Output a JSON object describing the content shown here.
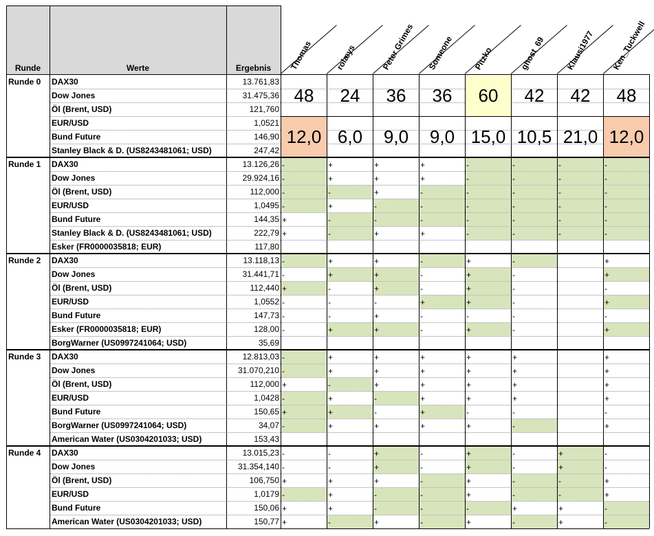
{
  "header": {
    "runde": "Runde",
    "werte": "Werte",
    "ergebnis": "Ergebnis"
  },
  "players": [
    "Thomas",
    "rolæys",
    "Peter Grimes",
    "Someone",
    "Pitzko",
    "ghost_69",
    "Klausi1977",
    "Ken_Tuckwell"
  ],
  "rounds": [
    {
      "label": "Runde 0",
      "rows": [
        {
          "werte": "DAX30",
          "ergebnis": "13.761,83"
        },
        {
          "werte": "Dow Jones",
          "ergebnis": "31.475,36"
        },
        {
          "werte": "Öl (Brent, USD)",
          "ergebnis": "121,760"
        },
        {
          "werte": "EUR/USD",
          "ergebnis": "1,0521"
        },
        {
          "werte": "Bund Future",
          "ergebnis": "146,90"
        },
        {
          "werte": "Stanley Black & D. (US8243481061; USD)",
          "ergebnis": "247,42"
        }
      ],
      "totals1": [
        "48",
        "24",
        "36",
        "36",
        "60",
        "42",
        "42",
        "48"
      ],
      "totals2": [
        "12,0",
        "6,0",
        "9,0",
        "9,0",
        "15,0",
        "10,5",
        "21,0",
        "12,0"
      ]
    },
    {
      "label": "Runde 1",
      "rows": [
        {
          "werte": "DAX30",
          "ergebnis": "13.126,26",
          "s": [
            "-",
            "+",
            "+",
            "+",
            "-",
            "-",
            "-",
            "-"
          ],
          "g": [
            1,
            0,
            0,
            0,
            1,
            1,
            1,
            1
          ]
        },
        {
          "werte": "Dow Jones",
          "ergebnis": "29.924,16",
          "s": [
            "-",
            "+",
            "+",
            "+",
            "-",
            "-",
            "-",
            "-"
          ],
          "g": [
            1,
            0,
            0,
            0,
            1,
            1,
            1,
            1
          ]
        },
        {
          "werte": "Öl (Brent, USD)",
          "ergebnis": "112,000",
          "s": [
            "-",
            "-",
            "+",
            "-",
            "-",
            "-",
            "-",
            "-"
          ],
          "g": [
            1,
            1,
            0,
            1,
            1,
            1,
            1,
            1
          ]
        },
        {
          "werte": "EUR/USD",
          "ergebnis": "1,0495",
          "s": [
            "-",
            "+",
            "-",
            "-",
            "-",
            "-",
            "-",
            "-"
          ],
          "g": [
            1,
            0,
            1,
            1,
            1,
            1,
            1,
            1
          ]
        },
        {
          "werte": "Bund Future",
          "ergebnis": "144,35",
          "s": [
            "+",
            "-",
            "-",
            "-",
            "-",
            "-",
            "-",
            "-"
          ],
          "g": [
            0,
            1,
            1,
            1,
            1,
            1,
            1,
            1
          ]
        },
        {
          "werte": "Stanley Black & D. (US8243481061; USD)",
          "ergebnis": "222,79",
          "s": [
            "+",
            "-",
            "+",
            "+",
            "-",
            "-",
            "-",
            "-"
          ],
          "g": [
            0,
            1,
            0,
            0,
            1,
            1,
            1,
            1
          ]
        },
        {
          "werte": "Esker (FR0000035818; EUR)",
          "ergebnis": "117,80",
          "s": [
            "",
            "",
            "",
            "",
            "",
            "",
            "",
            ""
          ],
          "g": [
            0,
            0,
            0,
            0,
            0,
            0,
            0,
            0
          ]
        }
      ]
    },
    {
      "label": "Runde 2",
      "rows": [
        {
          "werte": "DAX30",
          "ergebnis": "13.118,13",
          "s": [
            "-",
            "+",
            "+",
            "-",
            "+",
            "-",
            "",
            "+"
          ],
          "g": [
            1,
            0,
            0,
            1,
            0,
            1,
            0,
            0
          ]
        },
        {
          "werte": "Dow Jones",
          "ergebnis": "31.441,71",
          "s": [
            "-",
            "+",
            "+",
            "-",
            "+",
            "-",
            "",
            "+"
          ],
          "g": [
            0,
            1,
            1,
            0,
            1,
            0,
            0,
            1
          ]
        },
        {
          "werte": "Öl (Brent, USD)",
          "ergebnis": "112,440",
          "s": [
            "+",
            "-",
            "+",
            "-",
            "+",
            "-",
            "",
            "-"
          ],
          "g": [
            1,
            0,
            1,
            0,
            1,
            0,
            0,
            0
          ]
        },
        {
          "werte": "EUR/USD",
          "ergebnis": "1,0552",
          "s": [
            "-",
            "-",
            "-",
            "+",
            "+",
            "-",
            "",
            "+"
          ],
          "g": [
            0,
            0,
            0,
            1,
            1,
            0,
            0,
            1
          ]
        },
        {
          "werte": "Bund Future",
          "ergebnis": "147,73",
          "s": [
            "-",
            "-",
            "+",
            "-",
            "-",
            "-",
            "",
            "-"
          ],
          "g": [
            0,
            0,
            0,
            0,
            0,
            0,
            0,
            0
          ]
        },
        {
          "werte": "Esker (FR0000035818; EUR)",
          "ergebnis": "128,00",
          "s": [
            "-",
            "+",
            "+",
            "-",
            "+",
            "-",
            "",
            "+"
          ],
          "g": [
            0,
            1,
            1,
            0,
            1,
            0,
            0,
            1
          ]
        },
        {
          "werte": "BorgWarner (US0997241064; USD)",
          "ergebnis": "35,69",
          "s": [
            "",
            "",
            "",
            "",
            "",
            "",
            "",
            ""
          ],
          "g": [
            0,
            0,
            0,
            0,
            0,
            0,
            0,
            0
          ]
        }
      ]
    },
    {
      "label": "Runde 3",
      "rows": [
        {
          "werte": "DAX30",
          "ergebnis": "12.813,03",
          "s": [
            "-",
            "+",
            "+",
            "+",
            "+",
            "+",
            "",
            "+"
          ],
          "g": [
            1,
            0,
            0,
            0,
            0,
            0,
            0,
            0
          ]
        },
        {
          "werte": "Dow Jones",
          "ergebnis": "31.070,210",
          "s": [
            "-",
            "+",
            "+",
            "+",
            "+",
            "+",
            "",
            "+"
          ],
          "g": [
            1,
            0,
            0,
            0,
            0,
            0,
            0,
            0
          ]
        },
        {
          "werte": "Öl (Brent, USD)",
          "ergebnis": "112,000",
          "s": [
            "+",
            "-",
            "+",
            "+",
            "+",
            "+",
            "",
            "+"
          ],
          "g": [
            0,
            1,
            0,
            0,
            0,
            0,
            0,
            0
          ]
        },
        {
          "werte": "EUR/USD",
          "ergebnis": "1,0428",
          "s": [
            "-",
            "+",
            "-",
            "+",
            "+",
            "+",
            "",
            "+"
          ],
          "g": [
            1,
            0,
            1,
            0,
            0,
            0,
            0,
            0
          ]
        },
        {
          "werte": "Bund Future",
          "ergebnis": "150,65",
          "s": [
            "+",
            "+",
            "-",
            "+",
            "-",
            "-",
            "",
            "-"
          ],
          "g": [
            1,
            1,
            0,
            1,
            0,
            0,
            0,
            0
          ]
        },
        {
          "werte": "BorgWarner (US0997241064; USD)",
          "ergebnis": "34,07",
          "s": [
            "-",
            "+",
            "+",
            "+",
            "+",
            "-",
            "",
            "+"
          ],
          "g": [
            1,
            0,
            0,
            0,
            0,
            1,
            0,
            0
          ]
        },
        {
          "werte": "American Water (US0304201033; USD)",
          "ergebnis": "153,43",
          "s": [
            "",
            "",
            "",
            "",
            "",
            "",
            "",
            ""
          ],
          "g": [
            0,
            0,
            0,
            0,
            0,
            0,
            0,
            0
          ]
        }
      ]
    },
    {
      "label": "Runde 4",
      "rows": [
        {
          "werte": "DAX30",
          "ergebnis": "13.015,23",
          "s": [
            "-",
            "-",
            "+",
            "-",
            "+",
            "-",
            "+",
            "-"
          ],
          "g": [
            0,
            0,
            1,
            0,
            1,
            0,
            1,
            0
          ]
        },
        {
          "werte": "Dow Jones",
          "ergebnis": "31.354,140",
          "s": [
            "-",
            "-",
            "+",
            "-",
            "+",
            "-",
            "+",
            "-"
          ],
          "g": [
            0,
            0,
            1,
            0,
            1,
            0,
            1,
            0
          ]
        },
        {
          "werte": "Öl (Brent, USD)",
          "ergebnis": "106,750",
          "s": [
            "+",
            "+",
            "+",
            "-",
            "+",
            "-",
            "-",
            "+"
          ],
          "g": [
            0,
            0,
            0,
            1,
            0,
            1,
            1,
            0
          ]
        },
        {
          "werte": "EUR/USD",
          "ergebnis": "1,0179",
          "s": [
            "-",
            "+",
            "-",
            "-",
            "+",
            "-",
            "-",
            "+"
          ],
          "g": [
            1,
            0,
            1,
            1,
            0,
            1,
            1,
            0
          ]
        },
        {
          "werte": "Bund Future",
          "ergebnis": "150,06",
          "s": [
            "+",
            "+",
            "-",
            "-",
            "-",
            "+",
            "+",
            "-"
          ],
          "g": [
            0,
            0,
            1,
            1,
            1,
            0,
            0,
            1
          ]
        },
        {
          "werte": "American Water (US0304201033; USD)",
          "ergebnis": "150,77",
          "s": [
            "+",
            "-",
            "+",
            "-",
            "+",
            "-",
            "+",
            "-"
          ],
          "g": [
            0,
            1,
            0,
            1,
            0,
            1,
            0,
            1
          ]
        }
      ]
    }
  ]
}
